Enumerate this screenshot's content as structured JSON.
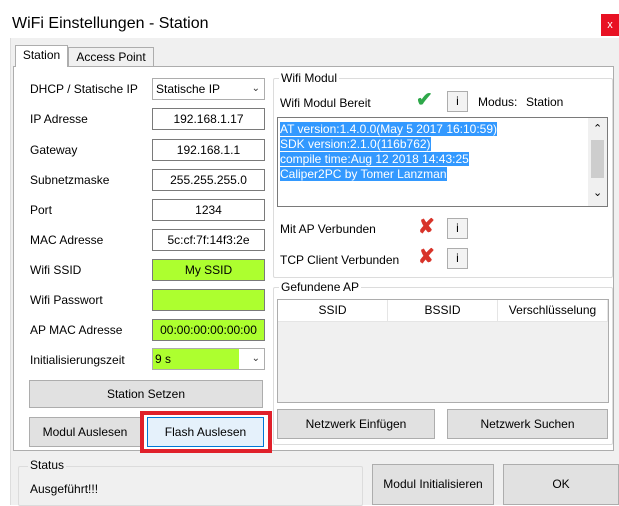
{
  "window": {
    "title": "WiFi Einstellungen - Station",
    "close_glyph": "x"
  },
  "tabs": [
    {
      "label": "Station"
    },
    {
      "label": "Access Point"
    }
  ],
  "form": {
    "dhcp": {
      "label": "DHCP / Statische IP",
      "value": "Statische IP"
    },
    "ip": {
      "label": "IP Adresse",
      "value": "192.168.1.17"
    },
    "gateway": {
      "label": "Gateway",
      "value": "192.168.1.1"
    },
    "subnet": {
      "label": "Subnetzmaske",
      "value": "255.255.255.0"
    },
    "port": {
      "label": "Port",
      "value": "1234"
    },
    "mac": {
      "label": "MAC Adresse",
      "value": "5c:cf:7f:14f3:2e"
    },
    "ssid": {
      "label": "Wifi SSID",
      "value": "My SSID"
    },
    "password": {
      "label": "Wifi Passwort",
      "value": ""
    },
    "ap_mac": {
      "label": "AP MAC Adresse",
      "value": "00:00:00:00:00:00"
    },
    "init_time": {
      "label": "Initialisierungszeit",
      "value": "9 s"
    }
  },
  "buttons": {
    "station_setzen": "Station Setzen",
    "modul_auslesen": "Modul Auslesen",
    "flash_auslesen": "Flash Auslesen",
    "netzwerk_einfuegen": "Netzwerk Einfügen",
    "netzwerk_suchen": "Netzwerk Suchen",
    "modul_initialisieren": "Modul Initialisieren",
    "ok": "OK",
    "info": "i"
  },
  "wifi_modul": {
    "title": "Wifi Modul",
    "bereit_label": "Wifi Modul Bereit",
    "modus_label": "Modus:",
    "modus_value": "Station",
    "log_lines": [
      "AT version:1.4.0.0(May  5 2017 16:10:59)",
      "SDK version:2.1.0(116b762)",
      "compile time:Aug 12 2018 14:43:25",
      "Caliper2PC by Tomer Lanzman"
    ],
    "ap_verbunden_label": "Mit AP Verbunden",
    "tcp_verbunden_label": "TCP Client Verbunden"
  },
  "gefundene_ap": {
    "title": "Gefundene AP",
    "columns": [
      "SSID",
      "BSSID",
      "Verschlüsselung"
    ]
  },
  "status": {
    "title": "Status",
    "text": "Ausgeführt!!!"
  },
  "icons": {
    "check": "✔",
    "cross": "✘",
    "dropdown": "⌄",
    "scroll_up": "⌃",
    "scroll_down": "⌄"
  },
  "colors": {
    "highlight_green": "#adff2f",
    "selection_blue": "#3399ff",
    "annotation_red": "#e0202a"
  }
}
